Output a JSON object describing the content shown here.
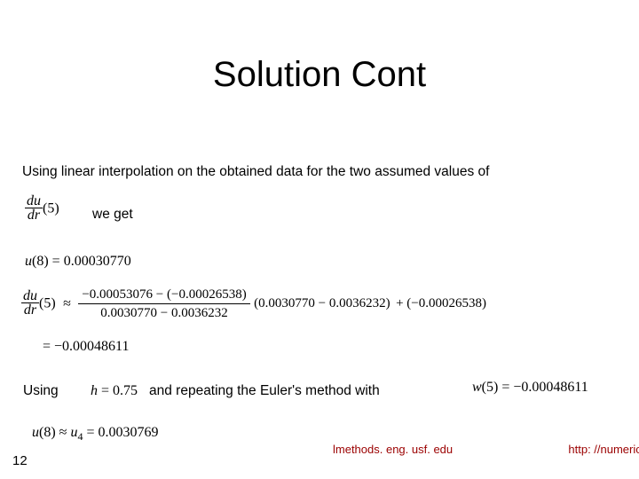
{
  "title": "Solution Cont",
  "line1": "Using linear interpolation on the obtained data for the two assumed values of",
  "weget": "we get",
  "eq_dudr_label_num": "du",
  "eq_dudr_label_den": "dr",
  "eq_dudr_arg": "(5)",
  "eq_u8_lhs": "u(8) = ",
  "eq_u8_rhs": "0.00030770",
  "big_eq": {
    "lhs_frac_num": "du",
    "lhs_frac_den": "dr",
    "lhs_arg": "(5)",
    "approx": "≈",
    "frac1_num": "−0.00053076 − (−0.00026538)",
    "frac1_den": "0.0030770 − 0.0036232",
    "mul_factor": "(0.0030770 − 0.0036232)",
    "plus": "+ (−0.00026538)"
  },
  "eq_final_lhs": "= ",
  "eq_final_rhs": "−0.00048611",
  "using2": "Using",
  "h_eq": "h = 0.75",
  "repeat_text": "and repeating the Euler's method with",
  "w5_eq": "w(5) = −0.00048611",
  "u8_final": "u(8) ≈ u₄ = 0.0030769",
  "slide_number": "12",
  "footer_mid": "lmethods. eng. usf. edu",
  "footer_right": "http: //numerica"
}
